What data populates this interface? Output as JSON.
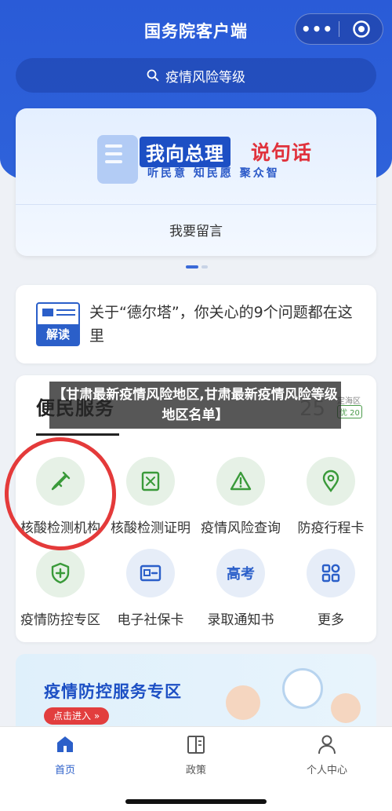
{
  "header": {
    "title": "国务院客户端",
    "more_glyph": "•••"
  },
  "search": {
    "text": "疫情风险等级"
  },
  "banner": {
    "title_a": "我向总理",
    "title_b": "说句话",
    "subtitle": "听民意 知民愿 聚众智",
    "link": "我要留言"
  },
  "notice": {
    "icon_word": "解读",
    "text": "关于“德尔塔”，你关心的9个问题都在这里"
  },
  "services": {
    "title": "便民服务",
    "weather": {
      "temp": "25",
      "place": "定海区",
      "aqi": "优 20"
    },
    "items": [
      {
        "label": "核酸检测机构",
        "icon": "dropper-icon"
      },
      {
        "label": "核酸检测证明",
        "icon": "certificate-icon"
      },
      {
        "label": "疫情风险查询",
        "icon": "warning-icon"
      },
      {
        "label": "防疫行程卡",
        "icon": "location-pin-icon"
      },
      {
        "label": "疫情防控专区",
        "icon": "shield-plus-icon"
      },
      {
        "label": "电子社保卡",
        "icon": "id-card-icon"
      },
      {
        "label": "录取通知书",
        "icon": "gaokao-icon",
        "icon_text": "高考"
      },
      {
        "label": "更多",
        "icon": "grid-apps-icon"
      }
    ]
  },
  "overlay": {
    "caption": "【甘肃最新疫情风险地区,甘肃最新疫情风险等级地区名单】"
  },
  "promo": {
    "title": "疫情防控服务专区",
    "button": "点击进入 »"
  },
  "tabbar": {
    "items": [
      {
        "label": "首页",
        "icon": "home-icon",
        "active": true
      },
      {
        "label": "政策",
        "icon": "book-icon",
        "active": false
      },
      {
        "label": "个人中心",
        "icon": "person-icon",
        "active": false
      }
    ]
  },
  "colors": {
    "brand_blue": "#2a5bd7",
    "accent_red": "#e0323c",
    "green_icon": "#3a9a3a",
    "blue_icon": "#2b5fc9"
  }
}
